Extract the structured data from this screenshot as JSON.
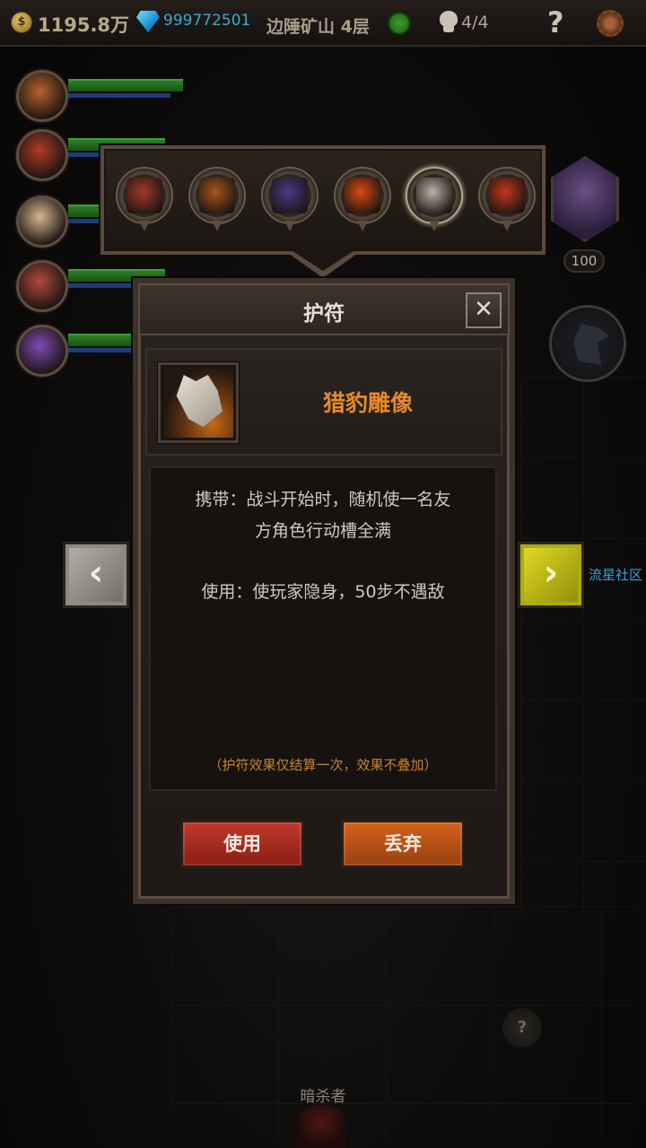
{
  "topbar": {
    "gold": "1195.8万",
    "gems": "999772501",
    "location": "边陲矿山 4层",
    "party_count": "4/4",
    "help": "?"
  },
  "party": [
    {
      "portrait_color": "#b5632c",
      "hp": 0.95
    },
    {
      "portrait_color": "#b23a2a",
      "hp": 0.8
    },
    {
      "portrait_color": "#d6b98e",
      "hp": 0.8
    },
    {
      "portrait_color": "#b04a3e",
      "hp": 0.8
    },
    {
      "portrait_color": "#7e4bb2",
      "hp": 0.8
    }
  ],
  "amulets": [
    {
      "icon": "drum-icon",
      "color": "#a3382a"
    },
    {
      "icon": "pipe-icon",
      "color": "#a6561c"
    },
    {
      "icon": "tome-icon",
      "color": "#4b3b86"
    },
    {
      "icon": "amber-orb-icon",
      "color": "#d84a12"
    },
    {
      "icon": "cheetah-statue-icon",
      "color": "#b9b2a6",
      "selected": true
    },
    {
      "icon": "carrot-sword-icon",
      "color": "#c4361a"
    }
  ],
  "side_badges": {
    "wing_level": "100"
  },
  "panel": {
    "title": "护符",
    "close": "✕",
    "item_name": "猎豹雕像",
    "carry_line1": "携带：战斗开始时，随机使一名友",
    "carry_line2": "方角色行动槽全满",
    "use_line": "使用：使玩家隐身，50步不遇敌",
    "note": "（护符效果仅结算一次，效果不叠加）",
    "use_button": "使用",
    "drop_button": "丢弃"
  },
  "nav": {
    "prev": "‹",
    "next": "›",
    "community": "流星社区"
  },
  "map": {
    "unknown_marker": "?",
    "unit_label": "暗杀者"
  }
}
